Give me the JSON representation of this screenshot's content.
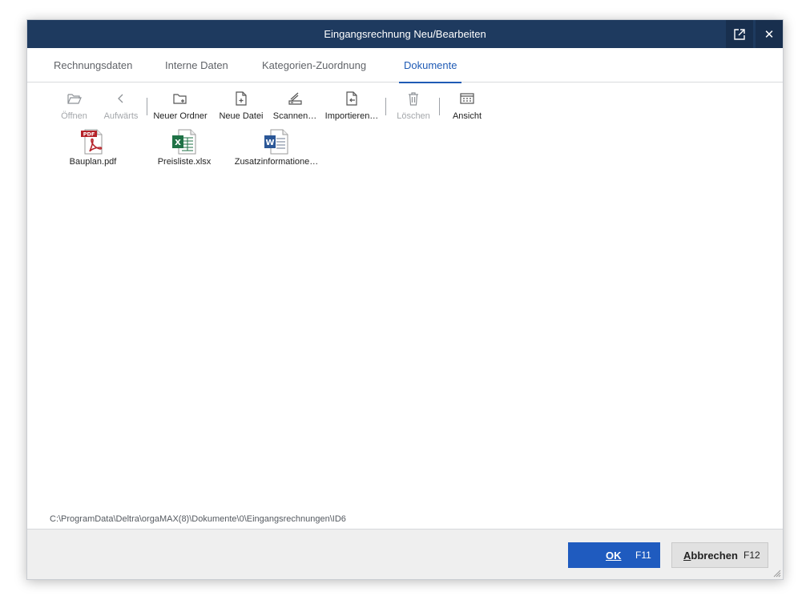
{
  "window": {
    "title": "Eingangsrechnung Neu/Bearbeiten",
    "popout_icon": "popout-icon",
    "close_label": "✕"
  },
  "tabs": [
    {
      "label": "Rechnungsdaten",
      "active": false
    },
    {
      "label": "Interne Daten",
      "active": false
    },
    {
      "label": "Kategorien-Zuordnung",
      "active": false
    },
    {
      "label": "Dokumente",
      "active": true
    }
  ],
  "toolbar": {
    "open": {
      "label": "Öffnen",
      "icon": "folder-open-icon",
      "enabled": false
    },
    "up": {
      "label": "Aufwärts",
      "icon": "chevron-left-icon",
      "enabled": false
    },
    "new_folder": {
      "label": "Neuer Ordner",
      "icon": "new-folder-icon",
      "enabled": true
    },
    "new_file": {
      "label": "Neue Datei",
      "icon": "new-file-icon",
      "enabled": true
    },
    "scan": {
      "label": "Scannen…",
      "icon": "scanner-icon",
      "enabled": true
    },
    "import": {
      "label": "Importieren…",
      "icon": "import-icon",
      "enabled": true
    },
    "delete": {
      "label": "Löschen",
      "icon": "trash-icon",
      "enabled": false
    },
    "view": {
      "label": "Ansicht",
      "icon": "grid-view-icon",
      "enabled": true
    }
  },
  "files": [
    {
      "name": "Bauplan.pdf",
      "icon": "pdf-file-icon",
      "badge": "PDF"
    },
    {
      "name": "Preisliste.xlsx",
      "icon": "excel-file-icon",
      "badge": "X"
    },
    {
      "name": "Zusatzinformatione…",
      "icon": "word-file-icon",
      "badge": "W"
    }
  ],
  "status": {
    "path": "C:\\ProgramData\\Deltra\\orgaMAX(8)\\Dokumente\\0\\Eingangsrechnungen\\ID6"
  },
  "footer": {
    "ok_label": "OK",
    "ok_key": "F11",
    "cancel_label_first": "A",
    "cancel_label_rest": "bbrechen",
    "cancel_key": "F12"
  },
  "colors": {
    "titlebar": "#1e3a5f",
    "accent": "#1f5bb5",
    "ok_button": "#1f5bbf",
    "pdf_red": "#b5232a",
    "excel_green": "#1f7246",
    "word_blue": "#2b5797"
  }
}
